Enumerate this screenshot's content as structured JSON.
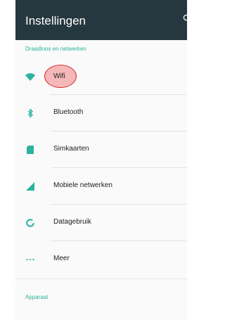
{
  "appbar": {
    "title": "Instellingen"
  },
  "sections": {
    "wireless": "Draadloos en netwerken",
    "device": "Apparaat"
  },
  "items": [
    {
      "label": "Wifi",
      "icon": "wifi-icon"
    },
    {
      "label": "Bluetooth",
      "icon": "bluetooth-icon"
    },
    {
      "label": "Simkaarten",
      "icon": "sim-card-icon"
    },
    {
      "label": "Mobiele netwerken",
      "icon": "cell-signal-icon"
    },
    {
      "label": "Datagebruik",
      "icon": "data-usage-icon"
    },
    {
      "label": "Meer",
      "icon": "more-icon"
    }
  ],
  "colors": {
    "appbar": "#26383f",
    "accent": "#2bb39e",
    "icon": "#2bb39e",
    "highlight_fill": "#f4b8b8",
    "highlight_border": "#d92c2c"
  }
}
